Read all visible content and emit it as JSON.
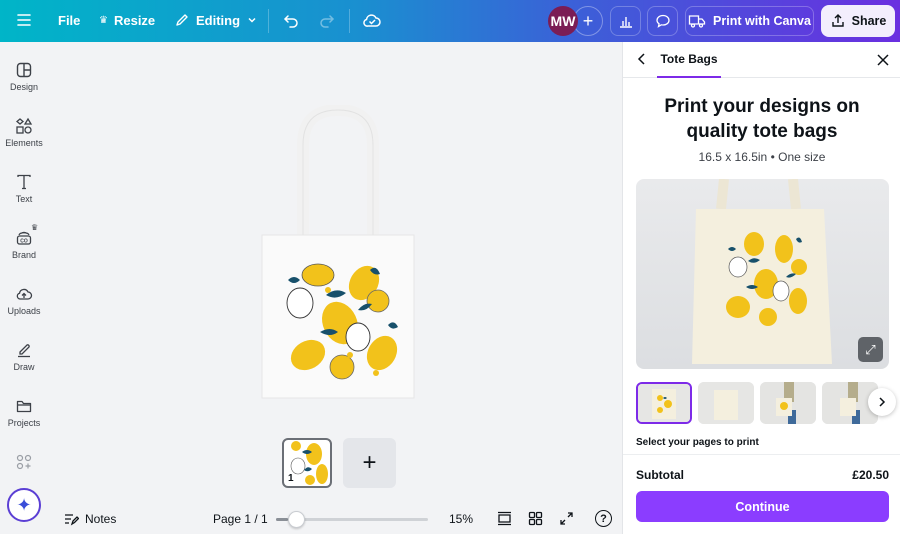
{
  "topbar": {
    "file_label": "File",
    "resize_label": "Resize",
    "editing_label": "Editing",
    "avatar_initials": "MW",
    "print_label": "Print with Canva",
    "share_label": "Share"
  },
  "sidebar": {
    "items": [
      {
        "label": "Design",
        "icon": "layout-icon"
      },
      {
        "label": "Elements",
        "icon": "shapes-icon"
      },
      {
        "label": "Text",
        "icon": "text-icon"
      },
      {
        "label": "Brand",
        "icon": "brand-icon"
      },
      {
        "label": "Uploads",
        "icon": "cloud-upload-icon"
      },
      {
        "label": "Draw",
        "icon": "pen-icon"
      },
      {
        "label": "Projects",
        "icon": "folder-icon"
      }
    ]
  },
  "canvas": {
    "page_number": "1",
    "add_page": "+"
  },
  "bottom_bar": {
    "notes_label": "Notes",
    "page_indicator": "Page 1 / 1",
    "zoom_level": "15%",
    "zoom_fraction": 0.08,
    "help": "?"
  },
  "panel": {
    "tab_label": "Tote Bags",
    "title": "Print your designs on quality tote bags",
    "subtitle": "16.5 x 16.5in • One size",
    "select_pages_label": "Select your pages to print",
    "subtotal_label": "Subtotal",
    "subtotal_value": "£20.50",
    "continue_label": "Continue"
  },
  "colors": {
    "accent": "#8b3dff",
    "lemon": "#f2c21b",
    "leaf": "#17506b"
  }
}
